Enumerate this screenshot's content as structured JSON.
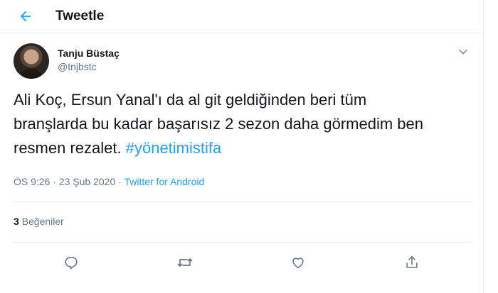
{
  "header": {
    "title": "Tweetle"
  },
  "author": {
    "display_name": "Tanju Büstaç",
    "handle": "@tnjbstc"
  },
  "tweet": {
    "text": "Ali Koç, Ersun Yanal'ı da al git geldiğinden beri tüm branşlarda bu kadar başarısız 2 sezon daha görmedim ben resmen rezalet. ",
    "hashtag": "#yönetimistifa"
  },
  "meta": {
    "time": "ÖS 9:26",
    "separator": " · ",
    "date": "23 Şub 2020",
    "source": "Twitter for Android"
  },
  "stats": {
    "likes_count": "3",
    "likes_label": "Beğeniler"
  },
  "colors": {
    "accent": "#1da1f2",
    "muted": "#657786",
    "text": "#14171a",
    "border": "#e6ecf0"
  },
  "icons": {
    "back": "arrow-left-icon",
    "more": "chevron-down-icon",
    "reply": "reply-icon",
    "retweet": "retweet-icon",
    "like": "heart-icon",
    "share": "share-icon"
  }
}
